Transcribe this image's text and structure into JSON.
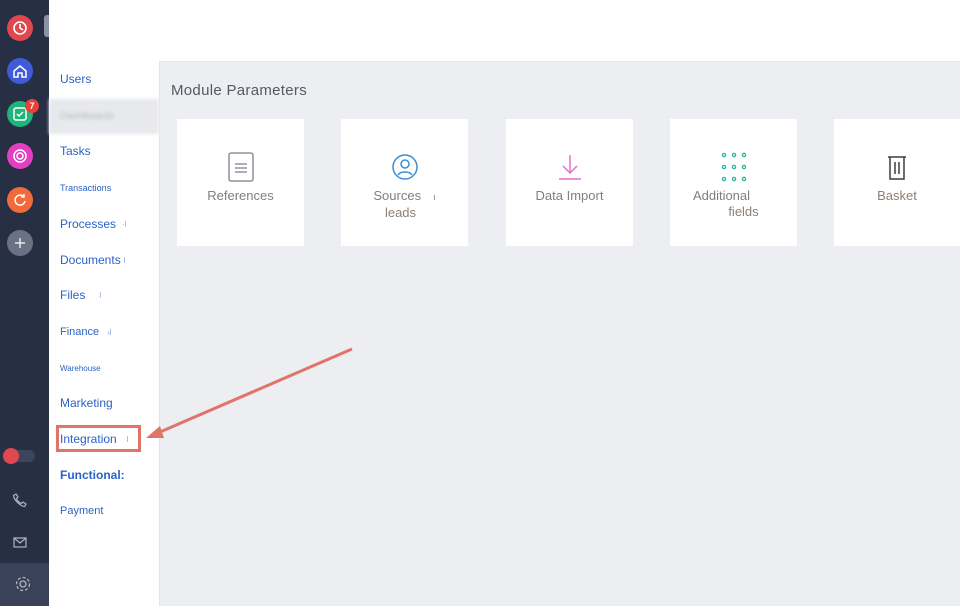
{
  "rail": {
    "notification_count": "7",
    "icons": [
      "clock-icon",
      "home-icon",
      "tasks-icon",
      "target-icon",
      "sync-icon",
      "plus-icon",
      "phone-icon",
      "mail-icon",
      "gear-icon"
    ],
    "colors": {
      "red": "#e0484f",
      "blue": "#3f5bd9",
      "green": "#1fb47a",
      "pink": "#e33fc2",
      "orange": "#f06a3a"
    }
  },
  "menu": {
    "items": [
      {
        "label": "Users",
        "count": ""
      },
      {
        "label": "Dashboards",
        "count": ""
      },
      {
        "label": "Tasks",
        "count": ""
      },
      {
        "label": "Transactions",
        "count": ""
      },
      {
        "label": "Processes",
        "count": "·l"
      },
      {
        "label": "Documents",
        "count": "l"
      },
      {
        "label": "Files",
        "count": "l"
      },
      {
        "label": "Finance",
        "count": "›l"
      },
      {
        "label": "Warehouse",
        "count": ""
      },
      {
        "label": "Marketing",
        "count": ""
      },
      {
        "label": "Integration",
        "count": "l"
      },
      {
        "label": "Functional:",
        "count": ""
      },
      {
        "label": "Payment",
        "count": ""
      }
    ]
  },
  "main": {
    "title": "Module Parameters",
    "cards": [
      {
        "label": "References",
        "label2": "",
        "icon": "document-icon"
      },
      {
        "label": "Sources",
        "label2": "leads",
        "side": "ı",
        "icon": "user-circle-icon"
      },
      {
        "label": "Data Import",
        "label2": "",
        "icon": "download-icon"
      },
      {
        "label": "Additional",
        "label2": "fields",
        "icon": "dots-grid-icon"
      },
      {
        "label": "Basket",
        "label2": "",
        "icon": "trash-icon"
      }
    ]
  }
}
